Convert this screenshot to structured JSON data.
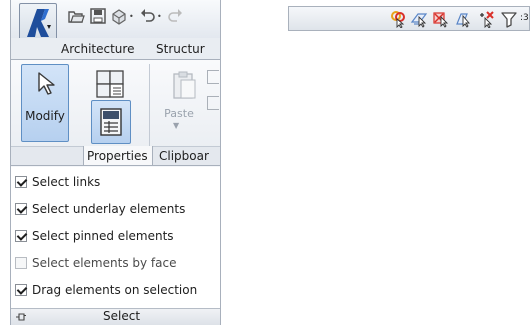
{
  "app": {
    "button_letter": "A",
    "brand_color": "#1f4e9c"
  },
  "quick_access": {
    "icons": [
      "open-icon",
      "save-icon",
      "sync-icon",
      "dropdown-icon",
      "undo-icon",
      "redo-icon"
    ]
  },
  "ribbon": {
    "tabs": [
      "Architecture",
      "Structur"
    ],
    "modify_label": "Modify",
    "paste_label": "Paste",
    "groups": [
      "Properties",
      "Clipboar"
    ]
  },
  "dropdown": {
    "options": [
      {
        "label": "Select links",
        "checked": true
      },
      {
        "label": "Select underlay elements",
        "checked": true
      },
      {
        "label": "Select pinned elements",
        "checked": true
      },
      {
        "label": "Select elements by face",
        "checked": false
      },
      {
        "label": "Drag elements on selection",
        "checked": true
      }
    ],
    "footer_label": "Select"
  },
  "status_bar": {
    "icons": [
      "select-links-icon",
      "select-underlay-icon",
      "select-pinned-icon",
      "select-by-face-icon",
      "drag-on-selection-icon",
      "filter-icon"
    ],
    "filter_count": ":3"
  },
  "colors": {
    "selected_fill": "#c5dbf5",
    "selected_border": "#5f8fc4",
    "accent_orange": "#e8a21b",
    "accent_red": "#d9302a"
  }
}
